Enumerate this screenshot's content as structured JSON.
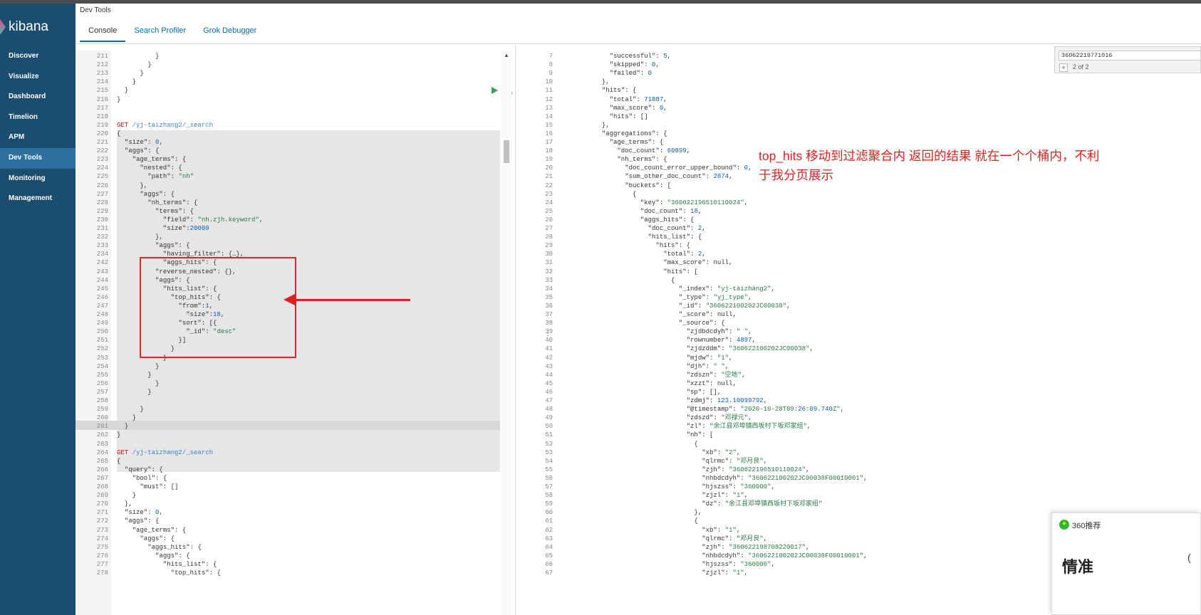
{
  "app": {
    "logo": "kibana"
  },
  "nav": {
    "items": [
      "Discover",
      "Visualize",
      "Dashboard",
      "Timelion",
      "APM",
      "Dev Tools",
      "Monitoring",
      "Management"
    ],
    "active": "Dev Tools"
  },
  "header": {
    "title": "Dev Tools",
    "tabs": [
      "Console",
      "Search Profiler",
      "Grok Debugger"
    ],
    "active_tab": "Console"
  },
  "editor_lines": [
    [
      "211",
      "          }"
    ],
    [
      "212",
      "        }"
    ],
    [
      "213",
      "      }"
    ],
    [
      "214",
      "    }"
    ],
    [
      "215",
      "  }"
    ],
    [
      "216",
      "}"
    ],
    [
      "217",
      ""
    ],
    [
      "218",
      ""
    ],
    [
      "219",
      "GET /yj-taizhang2/_search"
    ],
    [
      "220",
      "{"
    ],
    [
      "221",
      "  \"size\": 0,"
    ],
    [
      "222",
      "  \"aggs\": {"
    ],
    [
      "223",
      "    \"age_terms\": {"
    ],
    [
      "224",
      "      \"nested\": {"
    ],
    [
      "225",
      "        \"path\": \"nh\""
    ],
    [
      "226",
      "      },"
    ],
    [
      "227",
      "      \"aggs\": {"
    ],
    [
      "228",
      "        \"nh_terms\": {"
    ],
    [
      "229",
      "          \"terms\": {"
    ],
    [
      "230",
      "            \"field\": \"nh.zjh.keyword\","
    ],
    [
      "231",
      "            \"size\":20000"
    ],
    [
      "232",
      "          },"
    ],
    [
      "233",
      "          \"aggs\": {"
    ],
    [
      "234",
      "            \"having_filter\": {…},"
    ],
    [
      "242",
      "            \"aggs_hits\": {"
    ],
    [
      "243",
      "          \"reverse_nested\": {},"
    ],
    [
      "244",
      "          \"aggs\": {"
    ],
    [
      "245",
      "            \"hits_list\": {"
    ],
    [
      "246",
      "              \"top_hits\": {"
    ],
    [
      "247",
      "                \"from\":1,"
    ],
    [
      "248",
      "                  \"size\":18,"
    ],
    [
      "249",
      "                \"sort\": [{"
    ],
    [
      "250",
      "                  \"_id\": \"desc\""
    ],
    [
      "251",
      "                }]"
    ],
    [
      "252",
      "              }"
    ],
    [
      "253",
      "            }"
    ],
    [
      "254",
      "          }"
    ],
    [
      "255",
      "        }"
    ],
    [
      "256",
      "          }"
    ],
    [
      "257",
      "        }"
    ],
    [
      "258",
      ""
    ],
    [
      "259",
      "      }"
    ],
    [
      "260",
      "    }"
    ],
    [
      "261",
      "  }"
    ],
    [
      "262",
      "}"
    ],
    [
      "263",
      ""
    ],
    [
      "264",
      "GET /yj-taizhang2/_search"
    ],
    [
      "265",
      "{"
    ],
    [
      "266",
      "  \"query\": {"
    ],
    [
      "267",
      "    \"bool\": {"
    ],
    [
      "268",
      "      \"must\": []"
    ],
    [
      "269",
      "    }"
    ],
    [
      "270",
      "  },"
    ],
    [
      "271",
      "  \"size\": 0,"
    ],
    [
      "272",
      "  \"aggs\": {"
    ],
    [
      "273",
      "    \"age_terms\": {"
    ],
    [
      "274",
      "      \"aggs\": {"
    ],
    [
      "275",
      "        \"aggs_hits\": {"
    ],
    [
      "276",
      "          \"aggs\": {"
    ],
    [
      "277",
      "            \"hits_list\": {"
    ],
    [
      "278",
      "              \"top_hits\": {"
    ]
  ],
  "output_lines": [
    [
      "7",
      "    \"successful\": 5,"
    ],
    [
      "8",
      "    \"skipped\": 0,"
    ],
    [
      "9",
      "    \"failed\": 0"
    ],
    [
      "10",
      "  },"
    ],
    [
      "11",
      "  \"hits\": {"
    ],
    [
      "12",
      "    \"total\": 71887,"
    ],
    [
      "13",
      "    \"max_score\": 0,"
    ],
    [
      "14",
      "    \"hits\": []"
    ],
    [
      "15",
      "  },"
    ],
    [
      "16",
      "  \"aggregations\": {"
    ],
    [
      "17",
      "    \"age_terms\": {"
    ],
    [
      "18",
      "      \"doc_count\": 60899,"
    ],
    [
      "19",
      "      \"nh_terms\": {"
    ],
    [
      "20",
      "        \"doc_count_error_upper_bound\": 0,"
    ],
    [
      "21",
      "        \"sum_other_doc_count\": 2874,"
    ],
    [
      "22",
      "        \"buckets\": ["
    ],
    [
      "23",
      "          {"
    ],
    [
      "24",
      "            \"key\": \"360622196510110024\","
    ],
    [
      "25",
      "            \"doc_count\": 18,"
    ],
    [
      "26",
      "            \"aggs_hits\": {"
    ],
    [
      "27",
      "              \"doc_count\": 2,"
    ],
    [
      "28",
      "              \"hits_list\": {"
    ],
    [
      "29",
      "                \"hits\": {"
    ],
    [
      "30",
      "                  \"total\": 2,"
    ],
    [
      "31",
      "                  \"max_score\": null,"
    ],
    [
      "32",
      "                  \"hits\": ["
    ],
    [
      "33",
      "                    {"
    ],
    [
      "34",
      "                      \"_index\": \"yj-taizhang2\","
    ],
    [
      "35",
      "                      \"_type\": \"yj_type\","
    ],
    [
      "36",
      "                      \"_id\": \"360622100202JC00038\","
    ],
    [
      "37",
      "                      \"_score\": null,"
    ],
    [
      "38",
      "                      \"_source\": {"
    ],
    [
      "39",
      "                        \"zjdbdcdyh\": \" \","
    ],
    [
      "40",
      "                        \"rownumber\": 4897,"
    ],
    [
      "41",
      "                        \"zjdzddm\": \"360622100202JC00038\","
    ],
    [
      "42",
      "                        \"mjdw\": \"1\","
    ],
    [
      "43",
      "                        \"djh\": \" \","
    ],
    [
      "44",
      "                        \"zdszn\": \"空地\","
    ],
    [
      "45",
      "                        \"xzzt\": null,"
    ],
    [
      "46",
      "                        \"sp\": [],"
    ],
    [
      "47",
      "                        \"zdmj\": 123.10099792,"
    ],
    [
      "48",
      "                        \"@timestamp\": \"2020-10-28T09:26:09.740Z\","
    ],
    [
      "49",
      "                        \"zdszd\": \"邓禄元\","
    ],
    [
      "50",
      "                        \"zl\": \"余江县邓埠镇西坂村下坂邓家组\","
    ],
    [
      "51",
      "                        \"nh\": ["
    ],
    [
      "52",
      "                          {"
    ],
    [
      "53",
      "                            \"xb\": \"2\","
    ],
    [
      "54",
      "                            \"qlrmc\": \"邓月良\","
    ],
    [
      "55",
      "                            \"zjh\": \"360622196510110024\","
    ],
    [
      "56",
      "                            \"nhbdcdyh\": \"360622100202JC00038F00010001\","
    ],
    [
      "57",
      "                            \"hjszss\": \"360000\","
    ],
    [
      "58",
      "                            \"zjzl\": \"1\","
    ],
    [
      "59",
      "                            \"dz\": \"余江县邓埠镇西坂村下坂邓家组\""
    ],
    [
      "60",
      "                          },"
    ],
    [
      "61",
      "                          {"
    ],
    [
      "62",
      "                            \"xb\": \"1\","
    ],
    [
      "63",
      "                            \"qlrmc\": \"邓月良\","
    ],
    [
      "64",
      "                            \"zjh\": \"360622198708220017\","
    ],
    [
      "65",
      "                            \"nhbdcdyh\": \"360622100202JC00038F00010001\","
    ],
    [
      "66",
      "                            \"hjszss\": \"360000\","
    ],
    [
      "67",
      "                            \"zjzl\": \"1\","
    ]
  ],
  "annotation": "top_hits 移动到过滤聚合内 返回的结果 就在一个个桶内，不利于我分页展示",
  "search": {
    "value": "36062219771016",
    "count": "2 of 2"
  },
  "popup": {
    "title": "360推荐",
    "big": "情准"
  },
  "colors": {
    "sidebar": "#1b4d6e",
    "active_nav": "#2f6fa0",
    "annotation": "#e02020"
  }
}
